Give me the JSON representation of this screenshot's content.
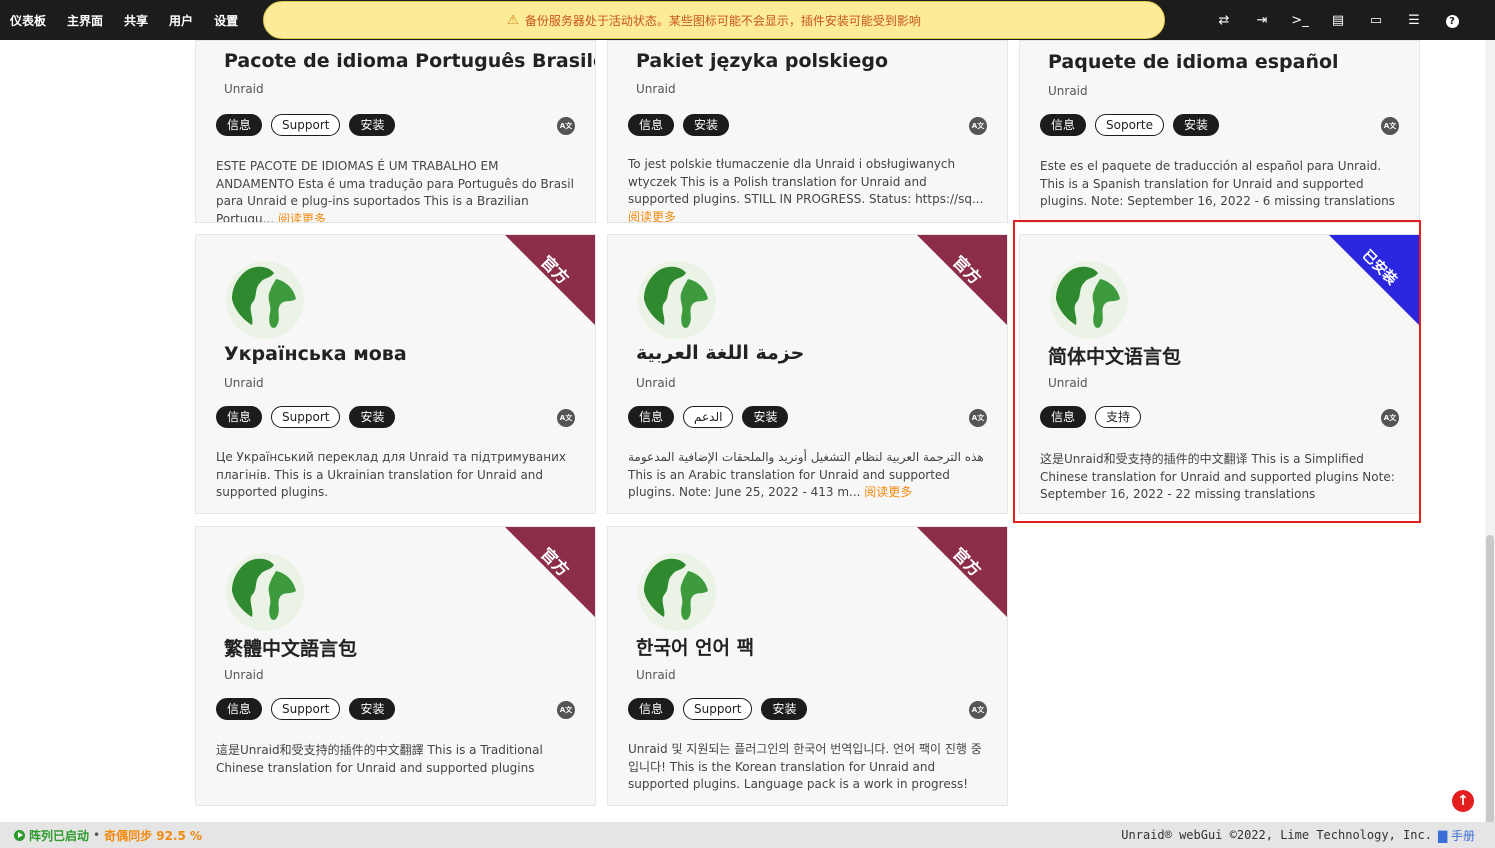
{
  "nav": [
    "仪表板",
    "主界面",
    "共享",
    "用户",
    "设置"
  ],
  "banner": "备份服务器处于活动状态。某些图标可能不会显示，插件安装可能受到影响",
  "labels": {
    "info": "信息",
    "install": "安装",
    "read_more": "阅读更多",
    "official": "官方",
    "installed": "已安装"
  },
  "cards": [
    {
      "title": "Pacote de idioma Português Brasileiro",
      "author": "Unraid",
      "support": "Support",
      "desc": "ESTE PACOTE DE IDIOMAS É UM TRABALHO EM ANDAMENTO Esta é uma tradução para Português do Brasil para Unraid e plug-ins suportados This is a Brazilian Portugu...",
      "more": "阅读更多"
    },
    {
      "title": "Pakiet języka polskiego",
      "author": "Unraid",
      "desc": "To jest polskie tłumaczenie dla Unraid i obsługiwanych wtyczek This is a Polish translation for Unraid and supported plugins. STILL IN PROGRESS. Status: https://sq...",
      "more": "阅读更多"
    },
    {
      "title": "Paquete de idioma español",
      "author": "Unraid",
      "support": "Soporte",
      "desc": "Este es el paquete de traducción al español para Unraid. This is a Spanish translation for Unraid and supported plugins. Note: September 16, 2022 - 6 missing translations"
    },
    {
      "title": "Українська мова",
      "author": "Unraid",
      "support": "Support",
      "desc": "Це Український переклад для Unraid та підтримуваних плагінів. This is a Ukrainian translation for Unraid and supported plugins."
    },
    {
      "title": "حزمة اللغة العربية",
      "author": "Unraid",
      "support": "الدعم",
      "desc": "هذه الترجمة العربية لنظام التشغيل أونريد والملحقات الإضافية المدعومة This is an Arabic translation for Unraid and supported plugins. Note: June 25, 2022 - 413 m...",
      "more": "阅读更多"
    },
    {
      "title": "简体中文语言包",
      "author": "Unraid",
      "support": "支持",
      "desc": "这是Unraid和受支持的插件的中文翻译 This is a Simplified Chinese translation for Unraid and supported plugins Note: September 16, 2022 - 22 missing translations"
    },
    {
      "title": "繁體中文語言包",
      "author": "Unraid",
      "support": "Support",
      "desc": "這是Unraid和受支持的插件的中文翻譯 This is a Traditional Chinese translation for Unraid and supported plugins"
    },
    {
      "title": "한국어 언어 팩",
      "author": "Unraid",
      "support": "Support",
      "desc": "Unraid 및 지원되는 플러그인의 한국어 번역입니다. 언어 팩이 진행 중입니다! This is the Korean translation for Unraid and supported plugins. Language pack is a work in progress!"
    }
  ],
  "footer": {
    "array": "阵列已启动",
    "sep": "•",
    "parity": "奇偶同步 92.5 %",
    "copyright": "Unraid® webGui ©2022, Lime Technology, Inc.",
    "manual": "手册"
  }
}
